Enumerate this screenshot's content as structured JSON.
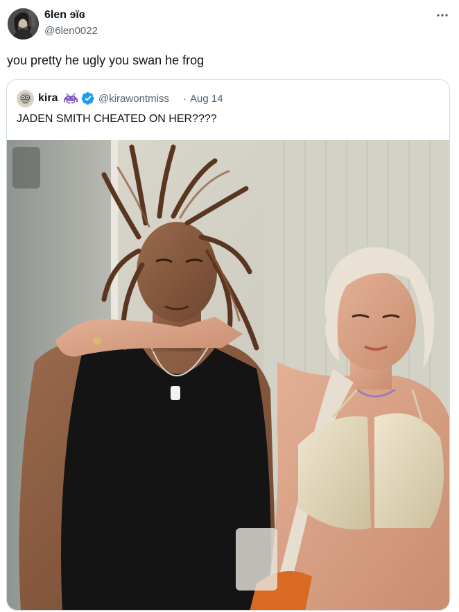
{
  "author": {
    "display_name": "6len ɘïɞ",
    "handle": "@6len0022",
    "avatar_icon": "user-avatar"
  },
  "more_icon": "more-horizontal-icon",
  "tweet": {
    "text": "you pretty he ugly you swan he frog"
  },
  "quoted_tweet": {
    "display_name": "kira",
    "badge_emoji_icon": "space-invader-emoji-icon",
    "verified_icon": "verified-badge-icon",
    "verified_color": "#1d9bf0",
    "handle": "@kirawontmiss",
    "separator": "·",
    "date": "Aug 14",
    "text": "JADEN SMITH CHEATED ON HER????",
    "media": "photo"
  },
  "colors": {
    "text_primary": "#0f1419",
    "text_secondary": "#536471",
    "border": "#cfd9de",
    "accent": "#1d9bf0"
  }
}
